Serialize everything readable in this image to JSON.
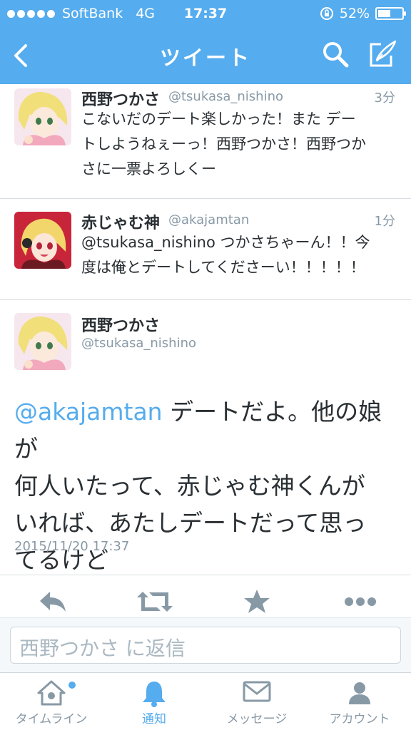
{
  "status": {
    "carrier": "SoftBank",
    "network": "4G",
    "time": "17:37",
    "battery": "52%",
    "battery_level": 0.52
  },
  "nav": {
    "title": "ツイート"
  },
  "tweets": [
    {
      "name": "西野つかさ",
      "handle": "@tsukasa_nishino",
      "time": "3分",
      "lines": [
        "こないだのデート楽しかった！また デー",
        "トしようねぇーっ！西野つかさ！西野つか",
        "さに一票よろしくー"
      ]
    },
    {
      "name": "赤じゃむ神",
      "handle": "@akajamtan",
      "time": "1分",
      "lines": [
        "@tsukasa_nishino つかさちゃーん！！今",
        "度は俺とデートしてくださーい！！！！！"
      ]
    }
  ],
  "main": {
    "name": "西野つかさ",
    "handle": "@tsukasa_nishino",
    "mention": "@akajamtan",
    "line1_rest": " デートだよ。他の娘が",
    "line2": "何人いたって、赤じゃむ神くんが",
    "line3": "いれば、あたしデートだって思っ",
    "line4": "てるけど",
    "date": "2015/11/20 17:37"
  },
  "reply": {
    "placeholder": "西野つかさ に返信"
  },
  "tabs": [
    {
      "label": "タイムライン",
      "icon": "home-icon"
    },
    {
      "label": "通知",
      "icon": "bell-icon"
    },
    {
      "label": "メッセージ",
      "icon": "envelope-icon"
    },
    {
      "label": "アカウント",
      "icon": "person-icon"
    }
  ],
  "colors": {
    "brand": "#55acee",
    "text": "#292f33",
    "muted": "#8899a6"
  }
}
